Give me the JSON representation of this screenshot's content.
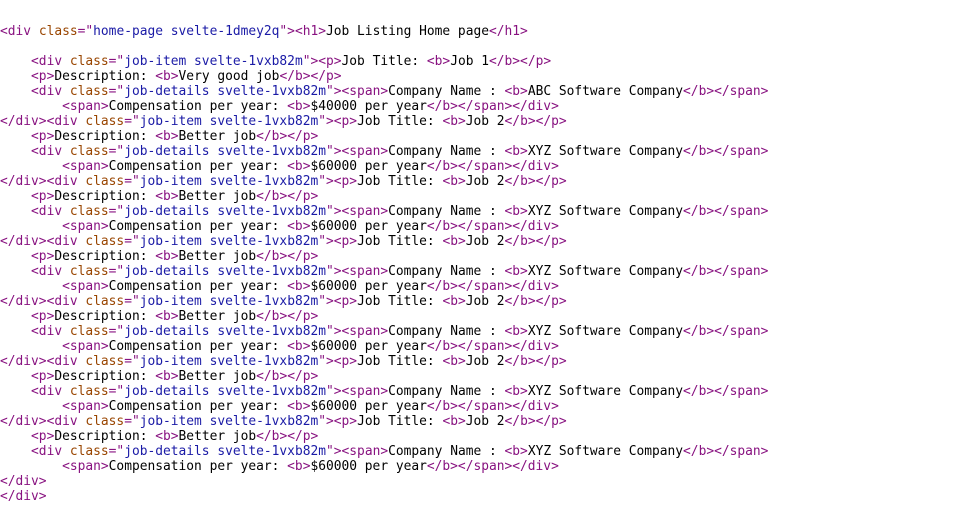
{
  "page": {
    "root_class": "home-page svelte-1dmey2q",
    "heading": "Job Listing Home page",
    "item_class": "job-item svelte-1vxb82m",
    "details_class": "job-details svelte-1vxb82m",
    "labels": {
      "title": "Job Title: ",
      "description": "Description: ",
      "company": "Company Name : ",
      "compensation": "Compensation per year: "
    },
    "jobs": [
      {
        "title": "Job 1",
        "description": "Very good job",
        "company": "ABC Software Company",
        "compensation": "$40000 per year"
      },
      {
        "title": "Job 2",
        "description": "Better job",
        "company": "XYZ Software Company",
        "compensation": "$60000 per year"
      },
      {
        "title": "Job 2",
        "description": "Better job",
        "company": "XYZ Software Company",
        "compensation": "$60000 per year"
      },
      {
        "title": "Job 2",
        "description": "Better job",
        "company": "XYZ Software Company",
        "compensation": "$60000 per year"
      },
      {
        "title": "Job 2",
        "description": "Better job",
        "company": "XYZ Software Company",
        "compensation": "$60000 per year"
      },
      {
        "title": "Job 2",
        "description": "Better job",
        "company": "XYZ Software Company",
        "compensation": "$60000 per year"
      },
      {
        "title": "Job 2",
        "description": "Better job",
        "company": "XYZ Software Company",
        "compensation": "$60000 per year"
      }
    ]
  },
  "colors": {
    "tag": "#881280",
    "attr_name": "#994500",
    "attr_value": "#1a1aa6",
    "text": "#000000"
  }
}
